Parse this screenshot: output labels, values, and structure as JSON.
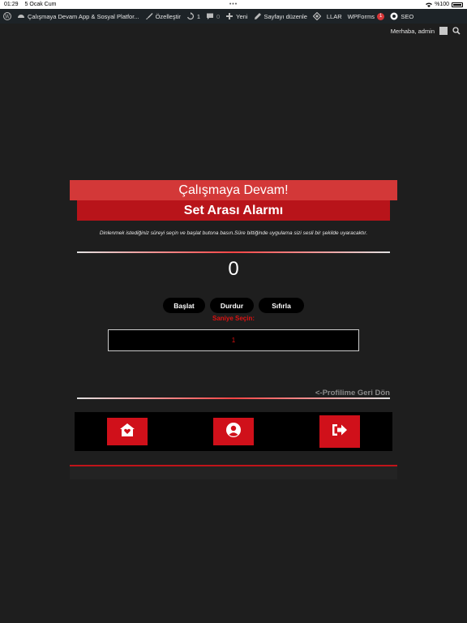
{
  "status_bar": {
    "time": "01:29",
    "date": "5 Ocak Cum",
    "battery": "%100"
  },
  "admin_bar": {
    "site_name": "Çalışmaya Devam App & Sosyal Platfor...",
    "customize": "Özelleştir",
    "updates_count": "1",
    "comments_count": "0",
    "new_label": "Yeni",
    "edit_page": "Sayfayı düzenle",
    "llar": "LLAR",
    "wpforms": "WPForms",
    "wpforms_badge": "1",
    "seo": "SEO",
    "greeting": "Merhaba, admin"
  },
  "main": {
    "title": "Çalışmaya Devam!",
    "subtitle": "Set Arası Alarmı",
    "description": "Dinlenmek istediğiniz süreyi seçin ve başlat butona basın.Süre bittiğinde uygulama sizi sesli bir şekilde uyaracaktır.",
    "counter": "0",
    "buttons": {
      "start": "Başlat",
      "stop": "Durdur",
      "reset": "Sıfırla"
    },
    "select_label": "Saniye Seçin:",
    "select_value": "1",
    "back_link": "<-Profilime Geri Dön"
  },
  "nav": {
    "icons": [
      "home-heart-icon",
      "user-circle-icon",
      "logout-icon"
    ]
  },
  "colors": {
    "accent": "#d0101a",
    "banner_light": "#d33838",
    "banner_dark": "#b8141a",
    "background": "#1e1e1e"
  }
}
